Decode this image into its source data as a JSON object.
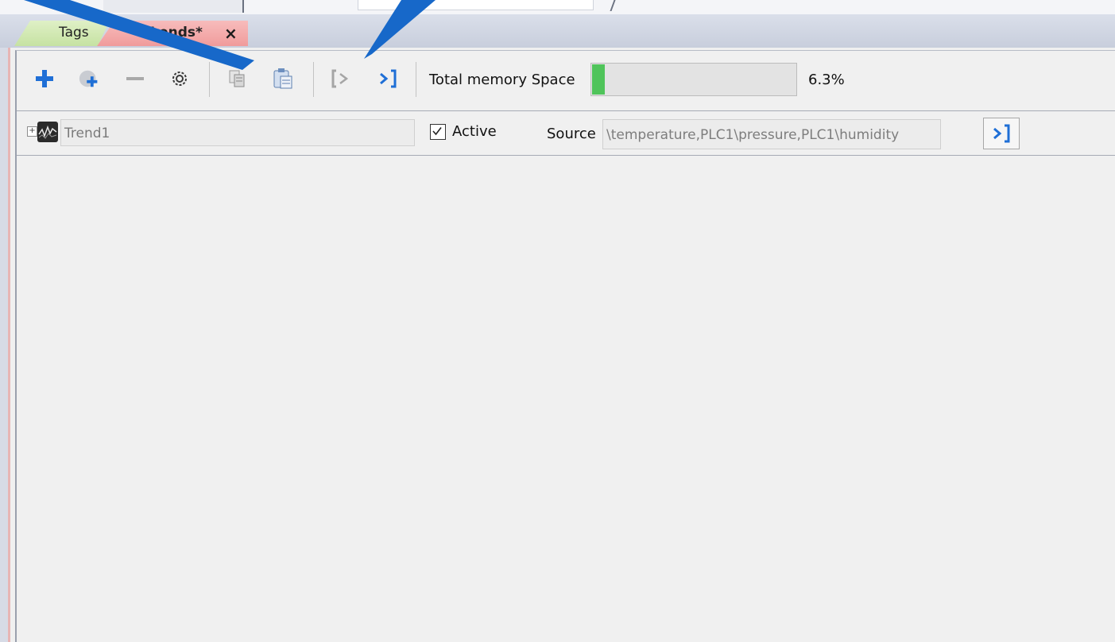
{
  "tabs": {
    "tags_label": "Tags",
    "trends_label": "Trends*",
    "close_glyph": "×"
  },
  "toolbar": {
    "memory_label": "Total memory Space",
    "memory_percent": "6.3%",
    "memory_fraction": 0.063,
    "icons": [
      "add-icon",
      "add-child-icon",
      "remove-icon",
      "settings-icon",
      "copy-icon",
      "paste-icon",
      "import-icon",
      "export-icon"
    ]
  },
  "trend_row": {
    "name": "Trend1",
    "expander": "+",
    "active_label": "Active",
    "active_checked": true,
    "source_label": "Source",
    "source_value": "\\temperature,PLC1\\pressure,PLC1\\humidity"
  },
  "colors": {
    "accent_blue": "#1f6fd6",
    "tags_tab": "#d4eab6",
    "trends_tab": "#f2a9a9",
    "memory_fill": "#4fc45a",
    "annotation_arrow": "#1768c9"
  }
}
